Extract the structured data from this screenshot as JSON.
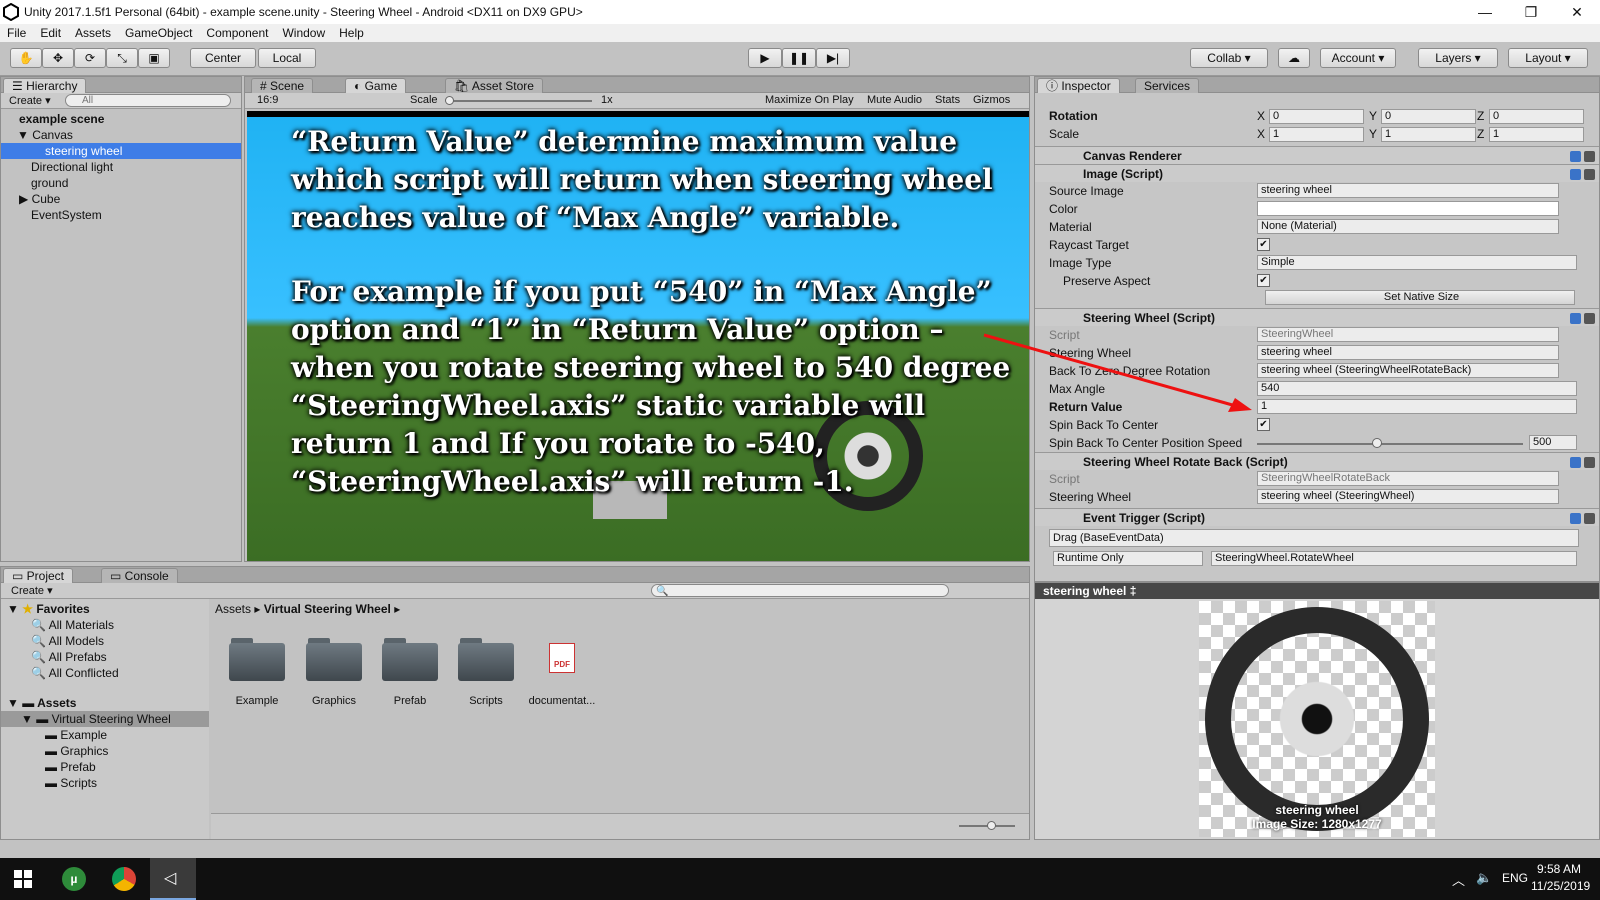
{
  "window": {
    "title": "Unity 2017.1.5f1 Personal (64bit) - example scene.unity - Steering Wheel - Android <DX11 on DX9 GPU>"
  },
  "menu": [
    "File",
    "Edit",
    "Assets",
    "GameObject",
    "Component",
    "Window",
    "Help"
  ],
  "toolbar": {
    "center": "Center",
    "local": "Local",
    "collab": "Collab ▾",
    "account": "Account",
    "layers": "Layers",
    "layout": "Layout"
  },
  "hierarchy": {
    "tab": "Hierarchy",
    "create": "Create ▾",
    "search_placeholder": "All",
    "scene": "example scene",
    "items": [
      "Canvas",
      "steering wheel",
      "Directional light",
      "ground",
      "Cube",
      "EventSystem"
    ]
  },
  "game": {
    "tabs": [
      "Scene",
      "Game",
      "Asset Store"
    ],
    "aspect": "16:9",
    "scale_label": "Scale",
    "scale_value": "1x",
    "buttons": [
      "Maximize On Play",
      "Mute Audio",
      "Stats",
      "Gizmos"
    ],
    "text1": "“Return Value” determine maximum value which script will return when steering wheel reaches value of “Max Angle” variable.",
    "text2": "For example if you put “540” in “Max Angle” option and “1” in “Return Value” option – when you rotate steering wheel to 540 degree “SteeringWheel.axis” static variable will return 1 and If you rotate to -540, “SteeringWheel.axis” will return -1."
  },
  "inspector": {
    "tabs": [
      "Inspector",
      "Services"
    ],
    "rotation_label": "Rotation",
    "rotation": [
      "0",
      "0",
      "0"
    ],
    "scale_label": "Scale",
    "scale": [
      "1",
      "1",
      "1"
    ],
    "canvas_renderer": "Canvas Renderer",
    "image_script": "Image (Script)",
    "source_image_label": "Source Image",
    "source_image": "steering wheel",
    "color_label": "Color",
    "material_label": "Material",
    "material": "None (Material)",
    "raycast_label": "Raycast Target",
    "image_type_label": "Image Type",
    "image_type": "Simple",
    "preserve_label": "Preserve Aspect",
    "set_native": "Set Native Size",
    "sw_script": "Steering Wheel (Script)",
    "script_label": "Script",
    "script_value": "SteeringWheel",
    "sw_label": "Steering Wheel",
    "sw_value": "steering wheel",
    "back_label": "Back To Zero Degree Rotation",
    "back_value": "steering wheel (SteeringWheelRotateBack)",
    "max_angle_label": "Max Angle",
    "max_angle": "540",
    "return_label": "Return Value",
    "return_value": "1",
    "spin_label": "Spin Back To Center",
    "spin_speed_label": "Spin Back To Center Position Speed",
    "spin_speed": "500",
    "rb_script": "Steering Wheel Rotate Back (Script)",
    "rb_script_value": "SteeringWheelRotateBack",
    "rb_sw_value": "steering wheel (SteeringWheel)",
    "event_trigger": "Event Trigger (Script)",
    "drag": "Drag (BaseEventData)",
    "runtime": "Runtime Only",
    "func": "SteeringWheel.RotateWheel",
    "preview_title": "steering wheel ‡",
    "preview_name": "steering wheel",
    "preview_size": "Image Size: 1280x1277"
  },
  "project": {
    "tabs": [
      "Project",
      "Console"
    ],
    "create": "Create ▾",
    "favorites": "Favorites",
    "fav_items": [
      "All Materials",
      "All Models",
      "All Prefabs",
      "All Conflicted"
    ],
    "assets": "Assets",
    "vsw": "Virtual Steering Wheel",
    "subfolders": [
      "Example",
      "Graphics",
      "Prefab",
      "Scripts"
    ],
    "breadcrumb": [
      "Assets",
      "Virtual Steering Wheel"
    ],
    "grid": [
      "Example",
      "Graphics",
      "Prefab",
      "Scripts",
      "documentat..."
    ]
  },
  "taskbar": {
    "lang": "ENG",
    "time": "9:58 AM",
    "date": "11/25/2019"
  }
}
